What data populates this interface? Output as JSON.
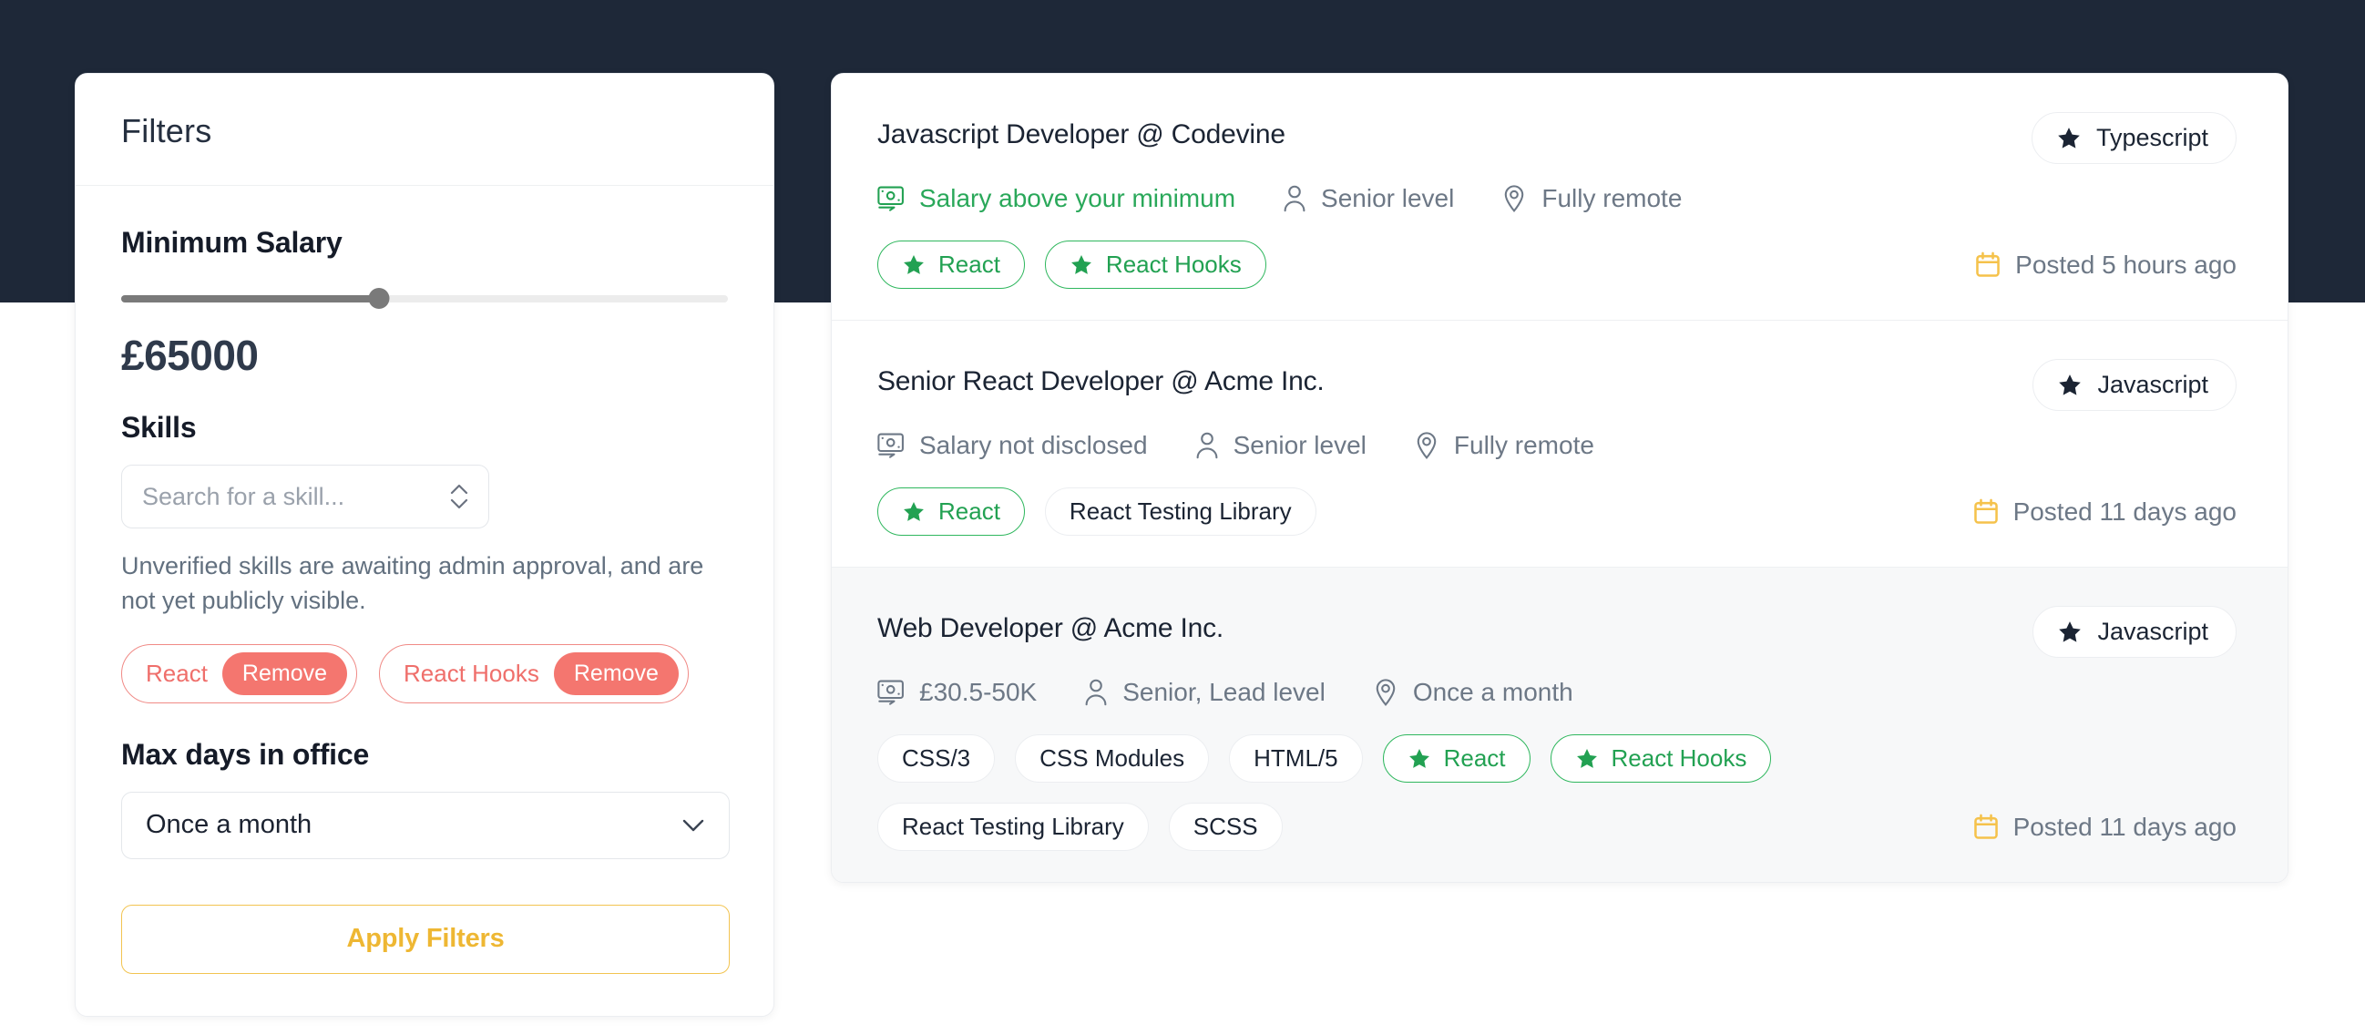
{
  "filters": {
    "title": "Filters",
    "salary": {
      "label": "Minimum Salary",
      "value_text": "£65000",
      "percent": 42.5
    },
    "skills": {
      "label": "Skills",
      "search_placeholder": "Search for a skill...",
      "hint": "Unverified skills are awaiting admin approval, and are not yet publicly visible.",
      "selected": [
        {
          "name": "React",
          "remove_label": "Remove"
        },
        {
          "name": "React Hooks",
          "remove_label": "Remove"
        }
      ]
    },
    "office": {
      "label": "Max days in office",
      "value": "Once a month"
    },
    "apply_label": "Apply Filters"
  },
  "results": [
    {
      "title": "Javascript Developer @ Codevine",
      "badge": "Typescript",
      "salary": "Salary above your minimum",
      "salary_highlight": true,
      "level": "Senior level",
      "location": "Fully remote",
      "tags": [
        {
          "label": "React",
          "match": true
        },
        {
          "label": "React Hooks",
          "match": true
        }
      ],
      "posted": "Posted 5 hours ago",
      "hovered": false
    },
    {
      "title": "Senior React Developer @ Acme Inc.",
      "badge": "Javascript",
      "salary": "Salary not disclosed",
      "salary_highlight": false,
      "level": "Senior level",
      "location": "Fully remote",
      "tags": [
        {
          "label": "React",
          "match": true
        },
        {
          "label": "React Testing Library",
          "match": false
        }
      ],
      "posted": "Posted 11 days ago",
      "hovered": false
    },
    {
      "title": "Web Developer @ Acme Inc.",
      "badge": "Javascript",
      "salary": "£30.5-50K",
      "salary_highlight": false,
      "level": "Senior, Lead level",
      "location": "Once a month",
      "tags": [
        {
          "label": "CSS/3",
          "match": false
        },
        {
          "label": "CSS Modules",
          "match": false
        },
        {
          "label": "HTML/5",
          "match": false
        },
        {
          "label": "React",
          "match": true
        },
        {
          "label": "React Hooks",
          "match": true
        },
        {
          "label": "React Testing Library",
          "match": false
        },
        {
          "label": "SCSS",
          "match": false
        }
      ],
      "posted": "Posted 11 days ago",
      "hovered": true
    }
  ],
  "colors": {
    "header_band": "#1e2838",
    "accent_yellow": "#eeb733",
    "match_green": "#22a152",
    "remove_red": "#f4766f",
    "calendar_yellow": "#f5c24b"
  }
}
